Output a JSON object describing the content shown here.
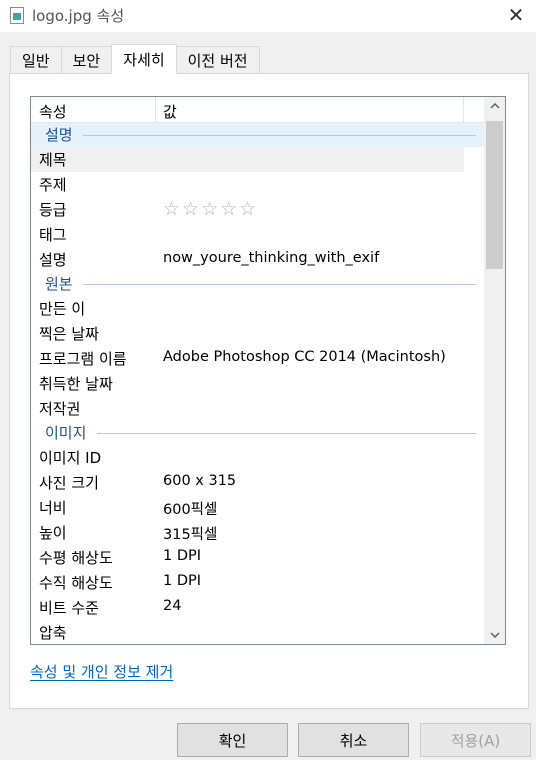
{
  "window": {
    "title": "logo.jpg 속성",
    "close_glyph": "✕"
  },
  "tabs": [
    {
      "label": "일반",
      "active": false
    },
    {
      "label": "보안",
      "active": false
    },
    {
      "label": "자세히",
      "active": true
    },
    {
      "label": "이전 버전",
      "active": false
    }
  ],
  "list": {
    "col_property": "속성",
    "col_value": "값",
    "groups": {
      "description": {
        "label": "설명",
        "title": {
          "key": "제목",
          "value": ""
        },
        "subject": {
          "key": "주제",
          "value": ""
        },
        "rating": {
          "key": "등급",
          "stars": "☆☆☆☆☆",
          "value": 0
        },
        "tags": {
          "key": "태그",
          "value": ""
        },
        "comments": {
          "key": "설명",
          "value": "now_youre_thinking_with_exif"
        }
      },
      "origin": {
        "label": "원본",
        "authors": {
          "key": "만든 이",
          "value": ""
        },
        "date_taken": {
          "key": "찍은 날짜",
          "value": ""
        },
        "program": {
          "key": "프로그램 이름",
          "value": "Adobe Photoshop CC 2014 (Macintosh)"
        },
        "date_acquired": {
          "key": "취득한 날짜",
          "value": ""
        },
        "copyright": {
          "key": "저작권",
          "value": ""
        }
      },
      "image": {
        "label": "이미지",
        "image_id": {
          "key": "이미지 ID",
          "value": ""
        },
        "dimensions": {
          "key": "사진 크기",
          "value": "600 x 315"
        },
        "width": {
          "key": "너비",
          "value": "600픽셀"
        },
        "height": {
          "key": "높이",
          "value": "315픽셀"
        },
        "hres": {
          "key": "수평 해상도",
          "value": "1 DPI"
        },
        "vres": {
          "key": "수직 해상도",
          "value": "1 DPI"
        },
        "bit_depth": {
          "key": "비트 수준",
          "value": "24"
        },
        "compression": {
          "key": "압축",
          "value": ""
        }
      }
    }
  },
  "remove_link": "속성 및 개인 정보 제거",
  "buttons": {
    "ok": "확인",
    "cancel": "취소",
    "apply": "적용(A)"
  },
  "colors": {
    "group_label": "#1e4f96",
    "link": "#0066cc",
    "selection": "#e5f1fb"
  }
}
